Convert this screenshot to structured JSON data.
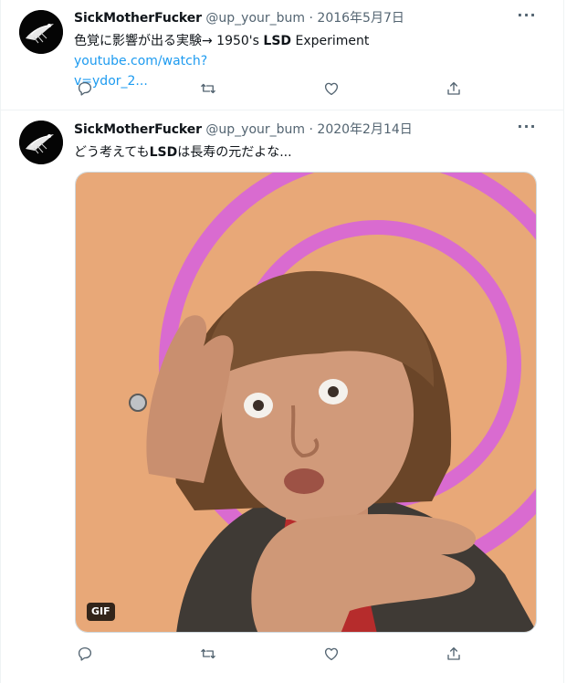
{
  "tweets": [
    {
      "author_name": "SickMotherFucker",
      "handle": "@up_your_bum",
      "separator": "·",
      "date": "2016年5月7日",
      "text_before": "色覚に影響が出る実験→ 1950's ",
      "text_bold": "LSD",
      "text_after": " Experiment ",
      "link_line1": "youtube.com/watch?",
      "link_line2": "v=ydor_2...",
      "more": "···"
    },
    {
      "author_name": "SickMotherFucker",
      "handle": "@up_your_bum",
      "separator": "·",
      "date": "2020年2月14日",
      "text_before": "どう考えても",
      "text_bold": "LSD",
      "text_after": "は長寿の元だよな...",
      "media_badge": "GIF",
      "more": "···"
    }
  ],
  "icons": [
    "reply-icon",
    "retweet-icon",
    "like-icon",
    "share-icon",
    "more-icon"
  ],
  "colors": {
    "link": "#1d9bf0",
    "secondary": "#536471",
    "border": "#eff3f4",
    "gif_background": "#e8a878",
    "gif_ring": "#d96bd0"
  }
}
